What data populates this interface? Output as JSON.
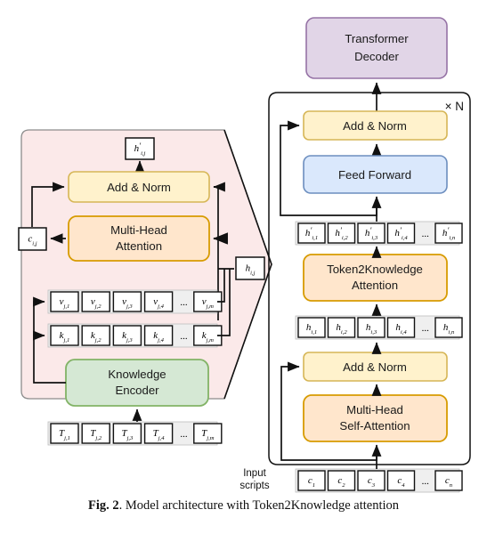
{
  "figure": {
    "caption_bold": "Fig. 2",
    "caption_rest": ". Model architecture with Token2Knowledge attention"
  },
  "right_stack": {
    "decoder": {
      "label": "Transformer Decoder",
      "line1": "Transformer",
      "line2": "Decoder",
      "fill": "#e1d5e7",
      "stroke": "#9673a6"
    },
    "repeat_label": "× N",
    "add_norm_top": {
      "label": "Add & Norm",
      "fill": "#fff2cc",
      "stroke": "#d6b656"
    },
    "feed_forward": {
      "label": "Feed Forward",
      "fill": "#dae8fc",
      "stroke": "#6c8ebf"
    },
    "token2knowledge": {
      "line1": "Token2Knowledge",
      "line2": "Attention",
      "fill": "#ffe6cc",
      "stroke": "#d79b00"
    },
    "add_norm_bottom": {
      "label": "Add & Norm",
      "fill": "#fff2cc",
      "stroke": "#d6b656"
    },
    "self_attention": {
      "line1": "Multi-Head",
      "line2": "Self-Attention",
      "fill": "#ffe6cc",
      "stroke": "#d79b00"
    },
    "h_prime_row": [
      {
        "sym": "h",
        "prime": true,
        "sub": "i,1"
      },
      {
        "sym": "h",
        "prime": true,
        "sub": "i,2"
      },
      {
        "sym": "h",
        "prime": true,
        "sub": "i,3"
      },
      {
        "sym": "h",
        "prime": true,
        "sub": "i,4"
      },
      {
        "sym": "...",
        "prime": false,
        "sub": ""
      },
      {
        "sym": "h",
        "prime": true,
        "sub": "i,n"
      }
    ],
    "h_row": [
      {
        "sym": "h",
        "prime": false,
        "sub": "i,1"
      },
      {
        "sym": "h",
        "prime": false,
        "sub": "i,2"
      },
      {
        "sym": "h",
        "prime": false,
        "sub": "i,3"
      },
      {
        "sym": "h",
        "prime": false,
        "sub": "i,4"
      },
      {
        "sym": "...",
        "prime": false,
        "sub": ""
      },
      {
        "sym": "h",
        "prime": false,
        "sub": "i,n"
      }
    ],
    "input_row": [
      {
        "sym": "c",
        "prime": false,
        "sub": "1"
      },
      {
        "sym": "c",
        "prime": false,
        "sub": "2"
      },
      {
        "sym": "c",
        "prime": false,
        "sub": "3"
      },
      {
        "sym": "c",
        "prime": false,
        "sub": "4"
      },
      {
        "sym": "...",
        "prime": false,
        "sub": ""
      },
      {
        "sym": "c",
        "prime": false,
        "sub": "n"
      }
    ],
    "input_label_line1": "Input",
    "input_label_line2": "scripts"
  },
  "left_panel": {
    "fill": "#fbe9e9",
    "stroke": "#8c8c8c",
    "output_box": {
      "sym": "h",
      "prime": true,
      "sub": "i,j"
    },
    "add_norm": {
      "label": "Add & Norm",
      "fill": "#fff2cc",
      "stroke": "#d6b656"
    },
    "multi_head": {
      "line1": "Multi-Head",
      "line2": "Attention",
      "fill": "#ffe6cc",
      "stroke": "#d79b00"
    },
    "context_box": {
      "sym": "c",
      "prime": false,
      "sub": "i,j"
    },
    "query_box": {
      "sym": "h",
      "prime": false,
      "sub": "i,j"
    },
    "knowledge_encoder": {
      "line1": "Knowledge",
      "line2": "Encoder",
      "fill": "#d5e8d4",
      "stroke": "#82b366"
    },
    "v_row": [
      {
        "sym": "v",
        "prime": false,
        "sub": "j,1"
      },
      {
        "sym": "v",
        "prime": false,
        "sub": "j,2"
      },
      {
        "sym": "v",
        "prime": false,
        "sub": "j,3"
      },
      {
        "sym": "v",
        "prime": false,
        "sub": "j,4"
      },
      {
        "sym": "...",
        "prime": false,
        "sub": ""
      },
      {
        "sym": "v",
        "prime": false,
        "sub": "j,m"
      }
    ],
    "k_row": [
      {
        "sym": "k",
        "prime": false,
        "sub": "j,1"
      },
      {
        "sym": "k",
        "prime": false,
        "sub": "j,2"
      },
      {
        "sym": "k",
        "prime": false,
        "sub": "j,3"
      },
      {
        "sym": "k",
        "prime": false,
        "sub": "j,4"
      },
      {
        "sym": "...",
        "prime": false,
        "sub": ""
      },
      {
        "sym": "k",
        "prime": false,
        "sub": "j,m"
      }
    ],
    "t_row": [
      {
        "sym": "T",
        "prime": false,
        "sub": "j,1"
      },
      {
        "sym": "T",
        "prime": false,
        "sub": "j,2"
      },
      {
        "sym": "T",
        "prime": false,
        "sub": "j,3"
      },
      {
        "sym": "T",
        "prime": false,
        "sub": "j,4"
      },
      {
        "sym": "...",
        "prime": false,
        "sub": ""
      },
      {
        "sym": "T",
        "prime": false,
        "sub": "j,m"
      }
    ]
  }
}
